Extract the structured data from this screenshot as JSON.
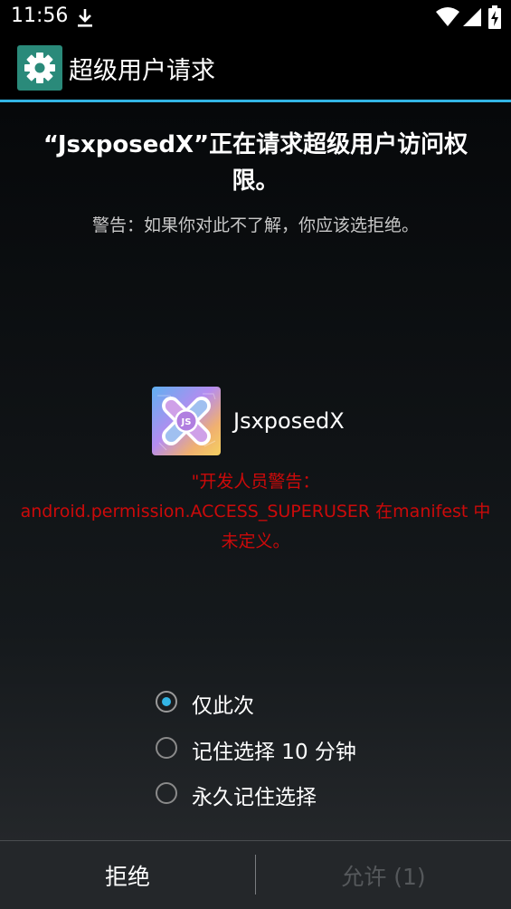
{
  "status_bar": {
    "time": "11:56",
    "icons": [
      "download-icon",
      "wifi-icon",
      "signal-icon",
      "battery-charging-icon"
    ]
  },
  "action_bar": {
    "icon": "settings-gear-icon",
    "title": "超级用户请求",
    "accent_color": "#33b5e5"
  },
  "request": {
    "title": "“JsxposedX”正在请求超级用户访问权限。",
    "warning": "警告：如果你对此不了解，你应该选拒绝。"
  },
  "app": {
    "name": "JsxposedX",
    "logo_text": "JS",
    "developer_warning": "\"开发人员警告：android.permission.ACCESS_SUPERUSER 在manifest 中未定义。",
    "developer_warning_color": "#cc0a0a"
  },
  "options": {
    "selected": "仅此次",
    "items": [
      {
        "label": "仅此次",
        "checked": true
      },
      {
        "label": "记住选择 10 分钟",
        "checked": false
      },
      {
        "label": "永久记住选择",
        "checked": false
      }
    ]
  },
  "buttons": {
    "deny_label": "拒绝",
    "allow_label": "允许 (1)",
    "allow_enabled": false
  }
}
